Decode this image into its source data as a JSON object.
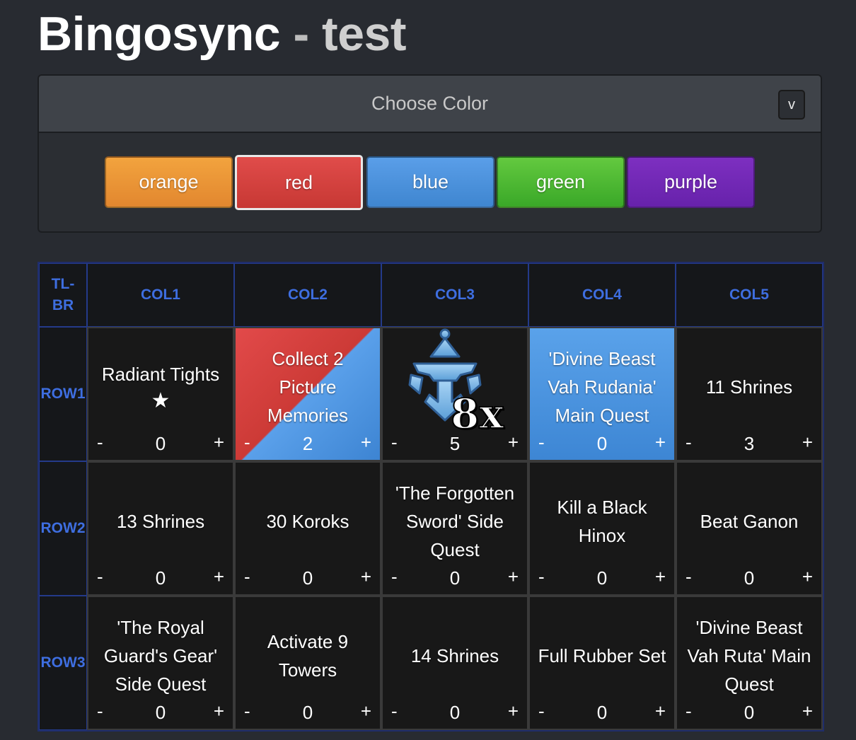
{
  "header": {
    "app": "Bingosync",
    "sep": " - ",
    "room": "test"
  },
  "panel": {
    "title": "Choose Color",
    "toggle": "v"
  },
  "colors": [
    "orange",
    "red",
    "blue",
    "green",
    "purple"
  ],
  "board": {
    "corner": [
      "TL-",
      "BR"
    ],
    "cols": [
      "COL1",
      "COL2",
      "COL3",
      "COL4",
      "COL5"
    ],
    "rows": [
      {
        "label": "ROW1",
        "cells": [
          {
            "text": [
              "Radiant Tights"
            ],
            "star": "★",
            "count": "0"
          },
          {
            "text": [
              "Collect 2",
              "Picture",
              "Memories"
            ],
            "count": "2",
            "color": "red+blue"
          },
          {
            "text": [],
            "icon": "divine-beast-icon",
            "badge": "8x",
            "count": "5"
          },
          {
            "text": [
              "'Divine Beast",
              "Vah Rudania'",
              "Main Quest"
            ],
            "count": "0",
            "color": "blue"
          },
          {
            "text": [
              "11 Shrines"
            ],
            "count": "3"
          }
        ]
      },
      {
        "label": "ROW2",
        "cells": [
          {
            "text": [
              "13 Shrines"
            ],
            "count": "0"
          },
          {
            "text": [
              "30 Koroks"
            ],
            "count": "0"
          },
          {
            "text": [
              "'The Forgotten",
              "Sword' Side",
              "Quest"
            ],
            "count": "0"
          },
          {
            "text": [
              "Kill a Black",
              "Hinox"
            ],
            "count": "0"
          },
          {
            "text": [
              "Beat Ganon"
            ],
            "count": "0"
          }
        ]
      },
      {
        "label": "ROW3",
        "cells": [
          {
            "text": [
              "'The Royal",
              "Guard's Gear'",
              "Side Quest"
            ],
            "count": "0"
          },
          {
            "text": [
              "Activate 9",
              "Towers"
            ],
            "count": "0"
          },
          {
            "text": [
              "14 Shrines"
            ],
            "count": "0"
          },
          {
            "text": [
              "Full Rubber Set"
            ],
            "count": "0"
          },
          {
            "text": [
              "'Divine Beast",
              "Vah Ruta' Main",
              "Quest"
            ],
            "count": "0"
          }
        ]
      }
    ],
    "counter": {
      "minus": "-",
      "plus": "+"
    }
  }
}
